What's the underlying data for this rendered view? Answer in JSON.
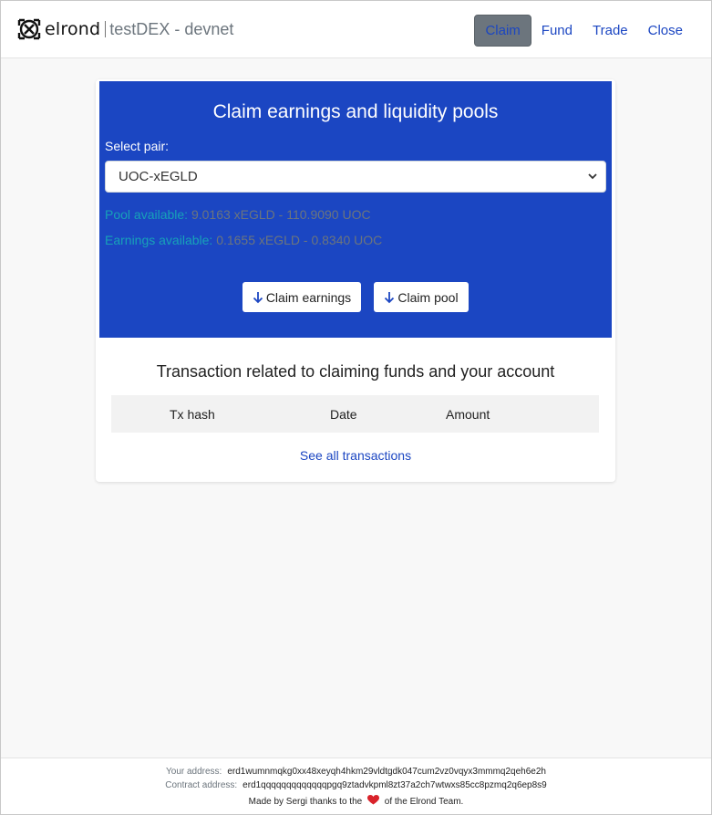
{
  "header": {
    "brand": "elrond",
    "app_title": "testDEX - devnet",
    "nav": [
      {
        "label": "Claim",
        "active": true
      },
      {
        "label": "Fund",
        "active": false
      },
      {
        "label": "Trade",
        "active": false
      },
      {
        "label": "Close",
        "active": false
      }
    ]
  },
  "claim_panel": {
    "title": "Claim earnings and liquidity pools",
    "select_label": "Select pair:",
    "selected_pair": "UOC-xEGLD",
    "pool_label": "Pool available:",
    "pool_value": "9.0163 xEGLD - 110.9090 UOC",
    "earnings_label": "Earnings available:",
    "earnings_value": "0.1655 xEGLD - 0.8340 UOC",
    "claim_earnings_label": "Claim earnings",
    "claim_pool_label": "Claim pool"
  },
  "transactions": {
    "title": "Transaction related to claiming funds and your account",
    "columns": [
      "Tx hash",
      "Date",
      "Amount"
    ],
    "see_all_label": "See all transactions"
  },
  "footer": {
    "your_address_label": "Your address:",
    "your_address": "erd1wumnmqkg0xx48xeyqh4hkm29vldtgdk047cum2vz0vqyx3mmmq2qeh6e2h",
    "contract_address_label": "Contract address:",
    "contract_address": "erd1qqqqqqqqqqqqqpgq9ztadvkpml8zt37a2ch7wtwxs85cc8pzmq2q6ep8s9",
    "made_by_prefix": "Made by Sergi thanks to the",
    "made_by_suffix": "of the Elrond Team."
  },
  "colors": {
    "primary": "#1b46c2",
    "info": "#17a2b8",
    "muted": "#6c757d",
    "heart": "#d9232b"
  }
}
